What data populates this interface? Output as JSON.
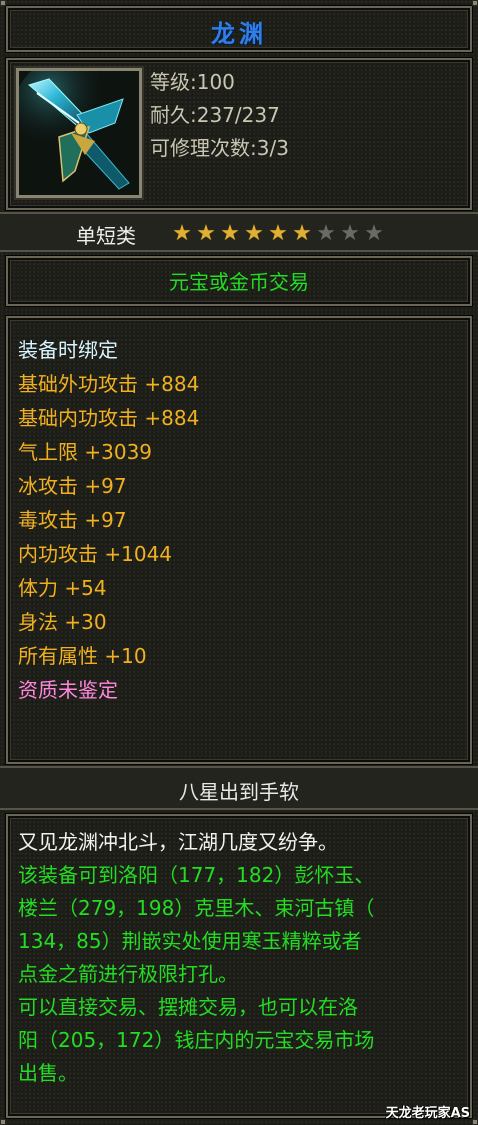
{
  "item": {
    "name": "龙渊",
    "level_label": "等级:100",
    "durability_label": "耐久:237/237",
    "repair_label": "可修理次数:3/3",
    "icon": "blue-dragon-blade-icon"
  },
  "category": {
    "label": "单短类",
    "stars_filled": 6,
    "stars_total": 9
  },
  "trade_note": "元宝或金币交易",
  "attributes": [
    {
      "text": "装备时绑定",
      "color": "#d8f4ff"
    },
    {
      "text": "基础外功攻击 +884",
      "color": "#f0b020"
    },
    {
      "text": "基础内功攻击 +884",
      "color": "#f0b020"
    },
    {
      "text": "气上限 +3039",
      "color": "#f0b020"
    },
    {
      "text": "冰攻击 +97",
      "color": "#f0b020"
    },
    {
      "text": "毒攻击 +97",
      "color": "#f0b020"
    },
    {
      "text": "内功攻击 +1044",
      "color": "#f0b020"
    },
    {
      "text": "体力 +54",
      "color": "#f0b020"
    },
    {
      "text": "身法 +30",
      "color": "#f0b020"
    },
    {
      "text": "所有属性 +10",
      "color": "#f0b020"
    },
    {
      "text": "资质未鉴定",
      "color": "#ff88dd"
    }
  ],
  "section_title": "八星出到手软",
  "description": [
    {
      "text": "又见龙渊冲北斗，江湖几度又纷争。",
      "style": "w"
    },
    {
      "text": "该装备可到洛阳（177，182）彭怀玉、",
      "style": "g"
    },
    {
      "text": "楼兰（279，198）克里木、束河古镇（",
      "style": "g"
    },
    {
      "text": "134，85）荆嵌实处使用寒玉精粹或者",
      "style": "g"
    },
    {
      "text": "点金之箭进行极限打孔。",
      "style": "g"
    },
    {
      "text": "可以直接交易、摆摊交易，也可以在洛",
      "style": "g"
    },
    {
      "text": "阳（205，172）钱庄内的元宝交易市场",
      "style": "g"
    },
    {
      "text": "出售。",
      "style": "g"
    }
  ],
  "watermark": "天龙老玩家AS"
}
